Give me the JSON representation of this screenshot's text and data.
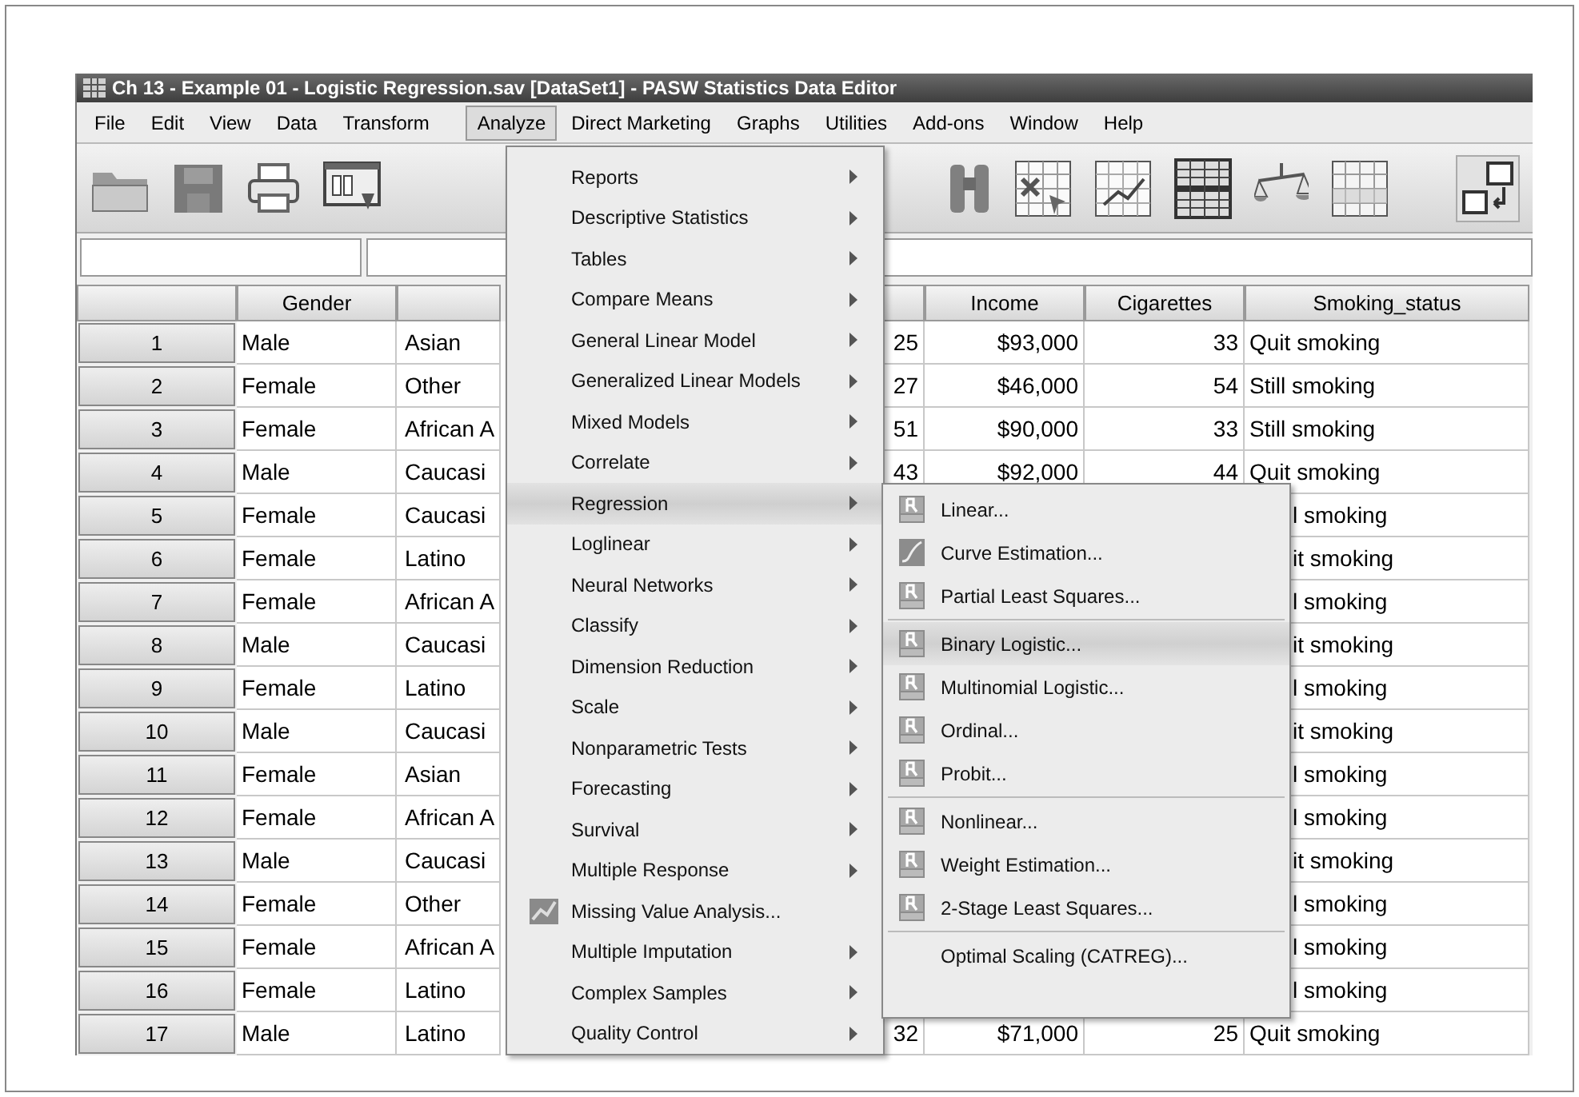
{
  "window": {
    "title": "Ch 13 - Example 01 - Logistic Regression.sav [DataSet1] - PASW Statistics Data Editor"
  },
  "menu_bar": [
    {
      "label": "File",
      "selected": false
    },
    {
      "label": "Edit",
      "selected": false
    },
    {
      "label": "View",
      "selected": false
    },
    {
      "label": "Data",
      "selected": false
    },
    {
      "label": "Transform",
      "selected": false
    },
    {
      "label": "Analyze",
      "selected": true
    },
    {
      "label": "Direct Marketing",
      "selected": false
    },
    {
      "label": "Graphs",
      "selected": false
    },
    {
      "label": "Utilities",
      "selected": false
    },
    {
      "label": "Add-ons",
      "selected": false
    },
    {
      "label": "Window",
      "selected": false
    },
    {
      "label": "Help",
      "selected": false
    }
  ],
  "table": {
    "headers": {
      "gender": "Gender",
      "income": "Income",
      "cigarettes": "Cigarettes",
      "smoking_status": "Smoking_status"
    },
    "rows": [
      {
        "number": "1",
        "gender": "Male",
        "column_3": "Asian",
        "column_4": "25",
        "income": "$93,000",
        "cigarettes": "33",
        "smoking_status": "Quit smoking"
      },
      {
        "number": "2",
        "gender": "Female",
        "column_3": "Other",
        "column_4": "27",
        "income": "$46,000",
        "cigarettes": "54",
        "smoking_status": "Still smoking"
      },
      {
        "number": "3",
        "gender": "Female",
        "column_3": "African A",
        "column_4": "51",
        "income": "$90,000",
        "cigarettes": "33",
        "smoking_status": "Still smoking"
      },
      {
        "number": "4",
        "gender": "Male",
        "column_3": "Caucasi",
        "column_4": "43",
        "income": "$92,000",
        "cigarettes": "44",
        "smoking_status": "Quit smoking"
      },
      {
        "number": "5",
        "gender": "Female",
        "column_3": "Caucasi",
        "smoking_status": "l smoking"
      },
      {
        "number": "6",
        "gender": "Female",
        "column_3": "Latino",
        "smoking_status": "it smoking"
      },
      {
        "number": "7",
        "gender": "Female",
        "column_3": "African A",
        "smoking_status": "l smoking"
      },
      {
        "number": "8",
        "gender": "Male",
        "column_3": "Caucasi",
        "smoking_status": "it smoking"
      },
      {
        "number": "9",
        "gender": "Female",
        "column_3": "Latino",
        "smoking_status": "l smoking"
      },
      {
        "number": "10",
        "gender": "Male",
        "column_3": "Caucasi",
        "smoking_status": "it smoking"
      },
      {
        "number": "11",
        "gender": "Female",
        "column_3": "Asian",
        "smoking_status": "l smoking"
      },
      {
        "number": "12",
        "gender": "Female",
        "column_3": "African A",
        "smoking_status": "l smoking"
      },
      {
        "number": "13",
        "gender": "Male",
        "column_3": "Caucasi",
        "smoking_status": "it smoking"
      },
      {
        "number": "14",
        "gender": "Female",
        "column_3": "Other",
        "smoking_status": "l smoking"
      },
      {
        "number": "15",
        "gender": "Female",
        "column_3": "African A",
        "smoking_status": "l smoking"
      },
      {
        "number": "16",
        "gender": "Female",
        "column_3": "Latino",
        "smoking_status": "l smoking"
      },
      {
        "number": "17",
        "gender": "Male",
        "column_3": "Latino",
        "column_4": "32",
        "income": "$71,000",
        "cigarettes": "25",
        "smoking_status": "Quit smoking"
      }
    ]
  },
  "analyze_menu": {
    "items": [
      {
        "label": "Reports",
        "kind": "submenu",
        "selected": false
      },
      {
        "label": "Descriptive Statistics",
        "kind": "submenu",
        "selected": false
      },
      {
        "label": "Tables",
        "kind": "submenu",
        "selected": false
      },
      {
        "label": "Compare Means",
        "kind": "submenu",
        "selected": false
      },
      {
        "label": "General Linear Model",
        "kind": "submenu",
        "selected": false
      },
      {
        "label": "Generalized Linear Models",
        "kind": "submenu",
        "selected": false
      },
      {
        "label": "Mixed Models",
        "kind": "submenu",
        "selected": false
      },
      {
        "label": "Correlate",
        "kind": "submenu",
        "selected": false
      },
      {
        "label": "Regression",
        "kind": "submenu",
        "selected": true
      },
      {
        "label": "Loglinear",
        "kind": "submenu",
        "selected": false
      },
      {
        "label": "Neural Networks",
        "kind": "submenu",
        "selected": false
      },
      {
        "label": "Classify",
        "kind": "submenu",
        "selected": false
      },
      {
        "label": "Dimension Reduction",
        "kind": "submenu",
        "selected": false
      },
      {
        "label": "Scale",
        "kind": "submenu",
        "selected": false
      },
      {
        "label": "Nonparametric Tests",
        "kind": "submenu",
        "selected": false
      },
      {
        "label": "Forecasting",
        "kind": "submenu",
        "selected": false
      },
      {
        "label": "Survival",
        "kind": "submenu",
        "selected": false
      },
      {
        "label": "Multiple Response",
        "kind": "submenu",
        "selected": false
      },
      {
        "label": "Missing Value Analysis...",
        "kind": "dialog",
        "selected": false
      },
      {
        "label": "Multiple Imputation",
        "kind": "submenu",
        "selected": false
      },
      {
        "label": "Complex Samples",
        "kind": "submenu",
        "selected": false
      },
      {
        "label": "Quality Control",
        "kind": "submenu",
        "selected": false
      }
    ]
  },
  "regression_submenu": {
    "groups": [
      [
        {
          "label": "Linear...",
          "kind": "r",
          "selected": false
        },
        {
          "label": "Curve Estimation...",
          "kind": "curve",
          "selected": false
        },
        {
          "label": "Partial Least Squares...",
          "kind": "r",
          "selected": false
        }
      ],
      [
        {
          "label": "Binary Logistic...",
          "kind": "r",
          "selected": true
        },
        {
          "label": "Multinomial Logistic...",
          "kind": "r",
          "selected": false
        },
        {
          "label": "Ordinal...",
          "kind": "r",
          "selected": false
        },
        {
          "label": "Probit...",
          "kind": "r",
          "selected": false
        }
      ],
      [
        {
          "label": "Nonlinear...",
          "kind": "r",
          "selected": false
        },
        {
          "label": "Weight Estimation...",
          "kind": "r",
          "selected": false
        },
        {
          "label": "2-Stage Least Squares...",
          "kind": "r",
          "selected": false
        }
      ],
      [
        {
          "label": "Optimal Scaling (CATREG)...",
          "kind": "plain",
          "selected": false
        }
      ]
    ]
  }
}
